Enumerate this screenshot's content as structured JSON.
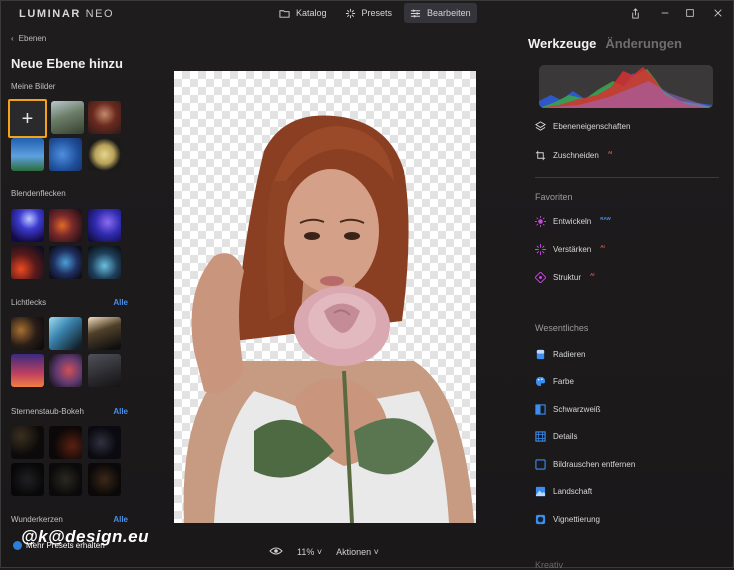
{
  "app": {
    "logo_main": "LUMINAR",
    "logo_sub": "NEO",
    "nav": [
      {
        "label": "Katalog",
        "icon": "folder-icon"
      },
      {
        "label": "Presets",
        "icon": "sparkle-icon"
      },
      {
        "label": "Bearbeiten",
        "icon": "sliders-icon",
        "active": true
      }
    ],
    "window_controls": [
      "share-icon",
      "minimize-icon",
      "maximize-icon",
      "close-icon"
    ]
  },
  "left": {
    "back_label": "Ebenen",
    "title": "Neue Ebene hinzu",
    "sections": {
      "meine_bilder": "Meine Bilder",
      "blendenflecken": "Blendenflecken",
      "lichtlecks": "Lichtlecks",
      "sternenstaub": "Sternenstaub-Bokeh",
      "wunderkerzen": "Wunderkerzen"
    },
    "alle_label": "Alle",
    "add_label": "+",
    "promo": "Mehr Presets erhalten",
    "watermark": "@k@design.eu"
  },
  "bottom": {
    "zoom": "11%",
    "actions": "Aktionen"
  },
  "right": {
    "tab_tools": "Werkzeuge",
    "tab_changes": "Änderungen",
    "top_tools": [
      {
        "label": "Ebeneneigenschaften",
        "icon": "layers-icon",
        "badge": ""
      },
      {
        "label": "Zuschneiden",
        "icon": "crop-icon",
        "badge": "AI"
      }
    ],
    "favoriten_title": "Favoriten",
    "favoriten": [
      {
        "label": "Entwickeln",
        "icon": "sun-icon",
        "badge": "RAW"
      },
      {
        "label": "Verstärken",
        "icon": "sparkle-purple-icon",
        "badge": "AI"
      },
      {
        "label": "Struktur",
        "icon": "structure-icon",
        "badge": "AI"
      }
    ],
    "wesentliches_title": "Wesentliches",
    "wesentliches": [
      {
        "label": "Radieren",
        "icon": "eraser-icon"
      },
      {
        "label": "Farbe",
        "icon": "palette-icon"
      },
      {
        "label": "Schwarzweiß",
        "icon": "bw-icon"
      },
      {
        "label": "Details",
        "icon": "details-icon"
      },
      {
        "label": "Bildrauschen entfernen",
        "icon": "denoise-icon"
      },
      {
        "label": "Landschaft",
        "icon": "landscape-icon"
      },
      {
        "label": "Vignettierung",
        "icon": "vignette-icon"
      }
    ],
    "next_section_partial": "Kreativ"
  },
  "colors": {
    "accent_blue": "#4a8fe8",
    "highlight_orange": "#f2a31a",
    "icon_blue": "#3b8ef0",
    "icon_purple": "#c44ae0"
  }
}
